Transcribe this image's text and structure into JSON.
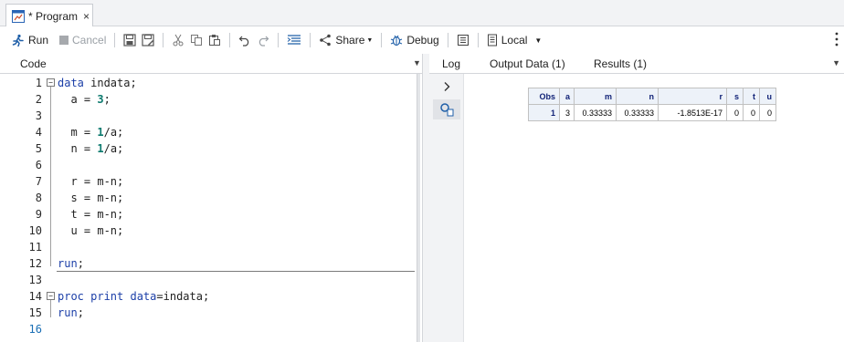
{
  "tab": {
    "title": "* Program",
    "close": "×"
  },
  "toolbar": {
    "run": "Run",
    "cancel": "Cancel",
    "share": "Share",
    "debug": "Debug",
    "server": "Local"
  },
  "code_panel": {
    "title": "Code"
  },
  "results_tabs": {
    "log": "Log",
    "output": "Output Data (1)",
    "results": "Results (1)"
  },
  "code_lines": [
    {
      "n": "1",
      "text": ""
    },
    {
      "n": "2",
      "text": ""
    },
    {
      "n": "3",
      "text": ""
    },
    {
      "n": "4",
      "text": ""
    },
    {
      "n": "5",
      "text": ""
    },
    {
      "n": "6",
      "text": ""
    },
    {
      "n": "7",
      "text": ""
    },
    {
      "n": "8",
      "text": ""
    },
    {
      "n": "9",
      "text": ""
    },
    {
      "n": "10",
      "text": ""
    },
    {
      "n": "11",
      "text": ""
    },
    {
      "n": "12",
      "text": ""
    },
    {
      "n": "13",
      "text": ""
    },
    {
      "n": "14",
      "text": ""
    },
    {
      "n": "15",
      "text": ""
    },
    {
      "n": "16",
      "text": ""
    }
  ],
  "code": {
    "l1_kw": "data",
    "l1_rest": " indata;",
    "l2_a": "  a = ",
    "l2_num": "3",
    "l2_end": ";",
    "l4_a": "  m = ",
    "l4_num": "1",
    "l4_end": "/a;",
    "l5_a": "  n = ",
    "l5_num": "1",
    "l5_end": "/a;",
    "l7": "  r = m-n;",
    "l8": "  s = m-n;",
    "l9": "  t = m-n;",
    "l10": "  u = m-n;",
    "l12_kw": "run",
    "l12_end": ";",
    "l14_kw": "proc print",
    "l14_mid": " ",
    "l14_kw2": "data",
    "l14_end": "=indata;",
    "l15_kw": "run",
    "l15_end": ";"
  },
  "table": {
    "headers": [
      "Obs",
      "a",
      "m",
      "n",
      "r",
      "s",
      "t",
      "u"
    ],
    "rows": [
      [
        "1",
        "3",
        "0.33333",
        "0.33333",
        "-1.8513E-17",
        "0",
        "0",
        "0"
      ]
    ]
  },
  "colors": {
    "keyword": "#1c3fa8",
    "number": "#0d7a6e",
    "table_header": "#edf2f9"
  },
  "icons": [
    "program-icon",
    "run-icon",
    "cancel-icon",
    "save-icon",
    "save-as-icon",
    "cut-icon",
    "copy-icon",
    "paste-icon",
    "undo-icon",
    "redo-icon",
    "format-code-icon",
    "share-icon",
    "debug-icon",
    "lines-icon",
    "server-icon",
    "more-icon",
    "chevron-right-icon",
    "results-icon"
  ]
}
